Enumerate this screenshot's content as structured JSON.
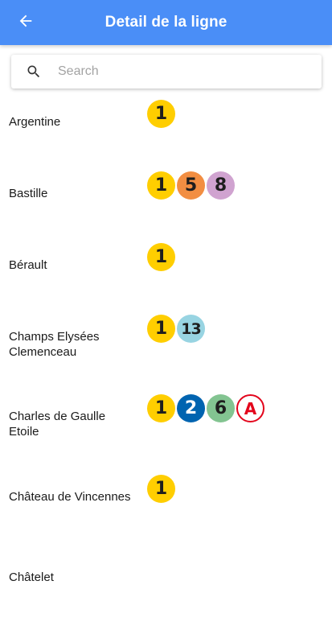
{
  "header": {
    "title": "Detail de la ligne",
    "back_icon": "arrow-left-icon"
  },
  "search": {
    "placeholder": "Search",
    "value": "",
    "icon": "search-icon"
  },
  "stations": [
    {
      "name": "Argentine",
      "lines": [
        "1"
      ]
    },
    {
      "name": "Bastille",
      "lines": [
        "1",
        "5",
        "8"
      ]
    },
    {
      "name": "Bérault",
      "lines": [
        "1"
      ]
    },
    {
      "name": "Champs Elysées Clemenceau",
      "lines": [
        "1",
        "13"
      ]
    },
    {
      "name": "Charles de Gaulle Etoile",
      "lines": [
        "1",
        "2",
        "6",
        "A"
      ]
    },
    {
      "name": "Château de Vincennes",
      "lines": [
        "1"
      ]
    },
    {
      "name": "Châtelet",
      "lines": []
    }
  ],
  "line_colors": {
    "1": "#ffce00",
    "2": "#0064b0",
    "5": "#f28e42",
    "6": "#83c491",
    "8": "#d0a3d0",
    "13": "#98d4e2",
    "A": "#e3051c"
  },
  "colors": {
    "appbar": "#4a8ef7"
  }
}
